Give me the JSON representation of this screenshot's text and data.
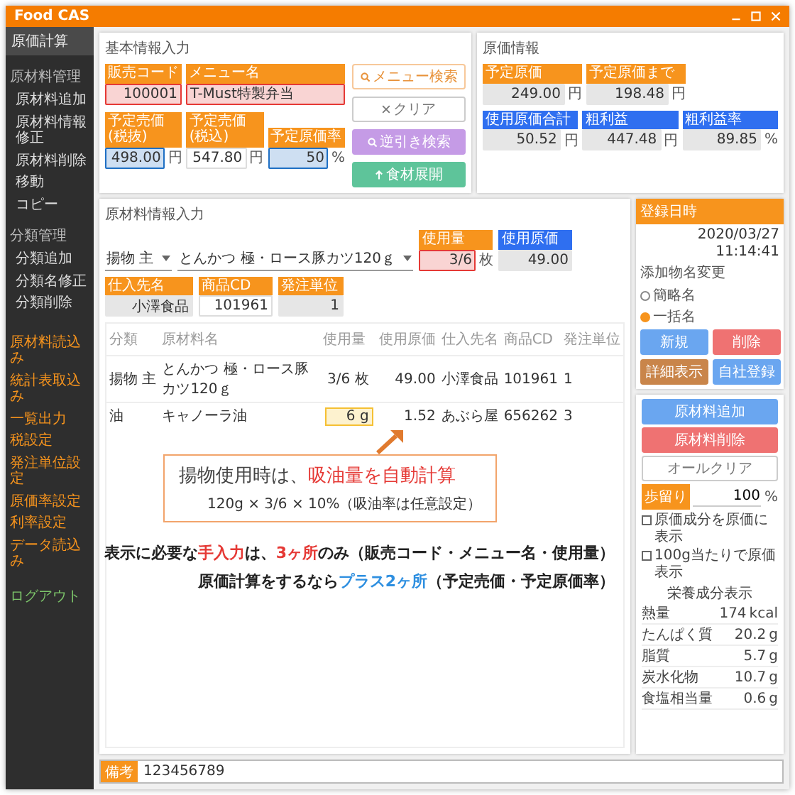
{
  "window": {
    "title": "Food CAS"
  },
  "sidebar": {
    "header": "原価計算",
    "groups": [
      {
        "title": "原材料管理",
        "items": [
          "原材料追加",
          "原材料情報修正",
          "原材料削除",
          "移動",
          "コピー"
        ]
      },
      {
        "title": "分類管理",
        "items": [
          "分類追加",
          "分類名修正",
          "分類削除"
        ]
      }
    ],
    "links": [
      "原材料読込み",
      "統計表取込み",
      "一覧出力",
      "税設定",
      "発注単位設定",
      "原価率設定",
      "利率設定",
      "データ読込み"
    ],
    "logout": "ログアウト"
  },
  "basic_info": {
    "title": "基本情報入力",
    "rows": [
      [
        {
          "label": "販売コード",
          "value": "100001",
          "kind": "number",
          "highlighted": true,
          "color": "#e53935"
        },
        {
          "label": "メニュー名",
          "value": "T-Must特製弁当",
          "kind": "text",
          "highlighted": true,
          "color": "#e53935"
        }
      ],
      [
        {
          "label": "予定売価(税抜)",
          "value": "498.00",
          "unit": "円",
          "kind": "number",
          "highlighted": true,
          "color": "#1e6fc4"
        },
        {
          "label": "予定売価(税込)",
          "value": "547.80",
          "unit": "円",
          "kind": "number",
          "highlighted": false,
          "editable": true
        },
        {
          "label": "予定原価率",
          "value": "50",
          "unit": "%",
          "kind": "number",
          "highlighted": true,
          "color": "#1e6fc4"
        }
      ]
    ],
    "buttons": [
      {
        "label": "メニュー検索",
        "kind": "outline-orange"
      },
      {
        "label": "クリア",
        "kind": "outline-grey"
      },
      {
        "label": "逆引き検索",
        "kind": "purple"
      },
      {
        "label": "食材展開",
        "kind": "green"
      }
    ]
  },
  "cost_info": {
    "title": "原価情報",
    "rows": [
      [
        {
          "label": "予定原価",
          "value": "249.00",
          "unit": "円",
          "kind": "orange"
        },
        {
          "label": "予定原価まで",
          "value": "198.48",
          "unit": "円",
          "kind": "orange"
        }
      ],
      [
        {
          "label": "使用原価合計",
          "value": "50.52",
          "unit": "円",
          "kind": "blue"
        },
        {
          "label": "粗利益",
          "value": "447.48",
          "unit": "円",
          "kind": "blue"
        },
        {
          "label": "粗利益率",
          "value": "89.85",
          "unit": "%",
          "kind": "blue"
        }
      ]
    ]
  },
  "registration": {
    "label": "登録日時",
    "value": "2020/03/27 11:14:41",
    "additive_label": "添加物名変更",
    "options": [
      {
        "label": "簡略名",
        "selected": false
      },
      {
        "label": "一括名",
        "selected": true
      }
    ],
    "buttons": [
      {
        "label": "新規",
        "kind": "blue"
      },
      {
        "label": "削除",
        "kind": "red"
      },
      {
        "label": "詳細表示",
        "kind": "brown"
      },
      {
        "label": "自社登録",
        "kind": "blue"
      }
    ]
  },
  "ingredient": {
    "title": "原材料情報入力",
    "category": "揚物 主",
    "name": "とんかつ 極・ロース豚カツ120ｇ",
    "fields": [
      {
        "label": "使用量",
        "value": "3/6",
        "unit": "枚",
        "kind": "orange",
        "highlighted": true,
        "color": "#e53935"
      },
      {
        "label": "使用原価",
        "value": "49.00",
        "kind": "blue",
        "highlighted": false,
        "editable": false
      },
      {
        "label": "仕入先名",
        "value": "小澤食品",
        "kind": "orange",
        "highlighted": false,
        "editable": false
      },
      {
        "label": "商品CD",
        "value": "101961",
        "kind": "orange",
        "highlighted": false,
        "editable": true
      },
      {
        "label": "発注単位",
        "value": "1",
        "kind": "orange",
        "highlighted": false,
        "editable": false
      }
    ],
    "table": {
      "columns": [
        "分類",
        "原材料名",
        "使用量",
        "使用原価",
        "仕入先名",
        "商品CD",
        "発注単位"
      ],
      "rows": [
        {
          "cells": [
            "揚物 主",
            "とんかつ 極・ロース豚カツ120ｇ",
            "3/6 枚",
            "49.00",
            "小澤食品",
            "101961",
            "1"
          ],
          "highlighted": false
        },
        {
          "cells": [
            "油",
            "キャノーラ油",
            "6 g",
            "1.52",
            "あぶら屋",
            "656262",
            "3"
          ],
          "highlighted": true
        }
      ]
    },
    "callout": {
      "parts": [
        {
          "text": "揚物使用時は、",
          "emphasis": false
        },
        {
          "text": "吸油量を自動計算",
          "emphasis": true
        }
      ],
      "formula": "120g × 3/6 × 10%（吸油率は任意設定）"
    },
    "notes": [
      [
        {
          "text": "表示に必要な"
        },
        {
          "text": "手入力",
          "color": "#e53935"
        },
        {
          "text": "は、"
        },
        {
          "text": "3ヶ所",
          "color": "#e53935"
        },
        {
          "text": "のみ（販売コード・メニュー名・使用量）"
        }
      ],
      [
        {
          "text": "原価計算をするなら"
        },
        {
          "text": "プラス2ヶ所",
          "color": "#2e8fe0"
        },
        {
          "text": "（予定売価・予定原価率）"
        }
      ]
    ],
    "side": {
      "buttons": [
        {
          "label": "原材料追加",
          "kind": "blue"
        },
        {
          "label": "原材料削除",
          "kind": "red"
        },
        {
          "label": "オールクリア",
          "kind": "outline"
        }
      ],
      "yield": {
        "label": "歩留り",
        "value": "100",
        "unit": "%"
      },
      "checks": [
        {
          "label": "原価成分を原価に表示",
          "checked": false
        },
        {
          "label": "100g当たりで原価表示",
          "checked": false
        }
      ],
      "nutrition": {
        "title": "栄養成分表示",
        "rows": [
          {
            "name": "熱量",
            "value": "174",
            "unit": "kcal"
          },
          {
            "name": "たんぱく質",
            "value": "20.2",
            "unit": "g"
          },
          {
            "name": "脂質",
            "value": "5.7",
            "unit": "g"
          },
          {
            "name": "炭水化物",
            "value": "10.7",
            "unit": "g"
          },
          {
            "name": "食塩相当量",
            "value": "0.6",
            "unit": "g"
          }
        ]
      }
    }
  },
  "remarks": {
    "label": "備考",
    "value": "123456789"
  }
}
